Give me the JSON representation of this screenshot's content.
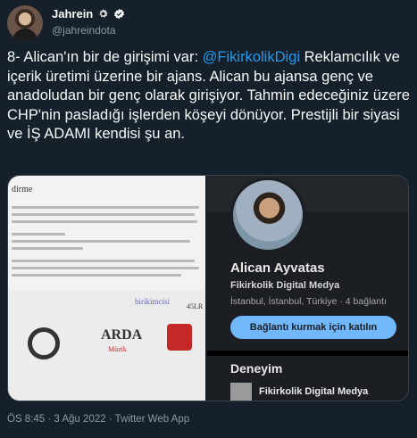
{
  "author": {
    "name": "Jahrein",
    "handle": "@jahreindota"
  },
  "tweet": {
    "lead": "8- Alican'ın bir de girişimi var: ",
    "mention": "@FikirkolikDigi",
    "body": " Reklamcılık ve içerik üretimi üzerine bir ajans. Alican bu ajansa genç ve anadoludan bir genç olarak girişiyor. Tahmin edeceğiniz üzere CHP'nin pasladığı işlerden köşeyi dönüyor. Prestijli bir siyasi ve İŞ ADAMI kendisi şu an."
  },
  "media": {
    "left": {
      "doc_title": "dirme",
      "logos": [
        "birikimcisi",
        "ARDA",
        "Müzik",
        "45LR"
      ]
    },
    "right": {
      "name": "Alican Ayvatas",
      "company": "Fikirkolik Digital Medya",
      "location": "İstanbul, İstanbul, Türkiye · 4 bağlantı",
      "connect_label": "Bağlantı kurmak için katılın",
      "section": "Deneyim",
      "experience": "Fikirkolik Digital Medya"
    }
  },
  "footer": {
    "meta": "ÖS 8:45 · 3 Ağu 2022 · Twitter Web App"
  },
  "colors": {
    "background": "#15202b",
    "accent": "#1d9bf0",
    "muted": "#8b98a5",
    "linkedin_button": "#71b7fb"
  }
}
